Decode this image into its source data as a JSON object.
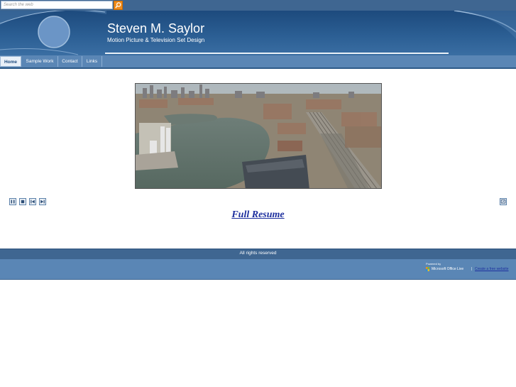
{
  "search": {
    "placeholder": "Search the web"
  },
  "header": {
    "title": "Steven M. Saylor",
    "subtitle": "Motion Picture & Television Set Design"
  },
  "nav": {
    "items": [
      {
        "label": "Home",
        "active": true
      },
      {
        "label": "Sample Work",
        "active": false
      },
      {
        "label": "Contact",
        "active": false
      },
      {
        "label": "Links",
        "active": false
      }
    ]
  },
  "main": {
    "resume_link": "Full Resume"
  },
  "footer": {
    "rights": "All rights reserved",
    "powered_by": "Powered by",
    "brand": "Microsoft Office Live",
    "separator": "|",
    "create_link": "Create a free website"
  },
  "colors": {
    "header_dark": "#1d4a7d",
    "nav_blue": "#5a86b5",
    "search_button": "#f08c1c",
    "link": "#1d2f9e"
  },
  "icons": [
    "search-icon",
    "pause-icon",
    "stop-icon",
    "previous-icon",
    "next-icon",
    "fullscreen-icon",
    "office-logo-icon"
  ]
}
